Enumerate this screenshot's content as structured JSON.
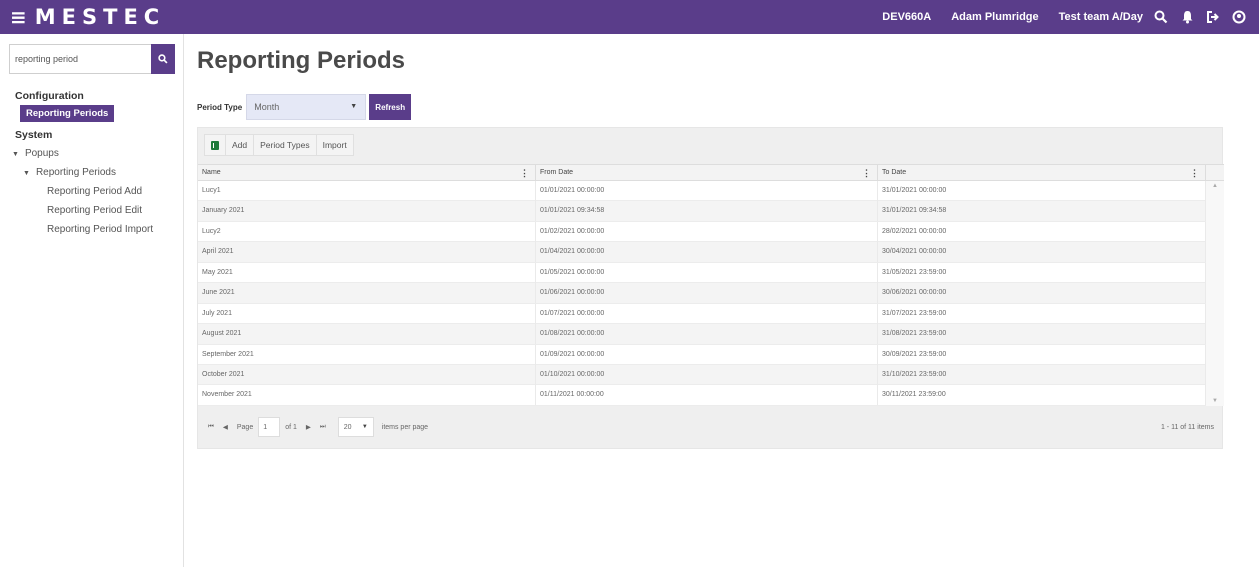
{
  "app": {
    "menu_icon": "hamburger-icon",
    "brand": "MESTEC"
  },
  "header": {
    "device": "DEV660A",
    "user": "Adam Plumridge",
    "team": "Test team A/Day",
    "icons": [
      "search-icon",
      "bell-icon",
      "logout-icon",
      "user-icon"
    ]
  },
  "sidebar": {
    "search_value": "reporting period",
    "search_icon": "search-icon",
    "configuration_label": "Configuration",
    "active_item": "Reporting Periods",
    "system_label": "System",
    "popups_label": "Popups",
    "reporting_periods_label": "Reporting Periods",
    "sub_items": [
      "Reporting Period Add",
      "Reporting Period Edit",
      "Reporting Period Import"
    ]
  },
  "main": {
    "title": "Reporting Periods",
    "filter": {
      "label": "Period Type",
      "value": "Month",
      "refresh_label": "Refresh"
    },
    "toolbar": {
      "excel_icon": "excel-icon",
      "add_label": "Add",
      "period_types_label": "Period Types",
      "import_label": "Import"
    },
    "grid": {
      "columns": [
        "Name",
        "From Date",
        "To Date"
      ],
      "rows": [
        [
          "Lucy1",
          "01/01/2021 00:00:00",
          "31/01/2021 00:00:00"
        ],
        [
          "January 2021",
          "01/01/2021 09:34:58",
          "31/01/2021 09:34:58"
        ],
        [
          "Lucy2",
          "01/02/2021 00:00:00",
          "28/02/2021 00:00:00"
        ],
        [
          "April 2021",
          "01/04/2021 00:00:00",
          "30/04/2021 00:00:00"
        ],
        [
          "May 2021",
          "01/05/2021 00:00:00",
          "31/05/2021 23:59:00"
        ],
        [
          "June 2021",
          "01/06/2021 00:00:00",
          "30/06/2021 00:00:00"
        ],
        [
          "July 2021",
          "01/07/2021 00:00:00",
          "31/07/2021 23:59:00"
        ],
        [
          "August 2021",
          "01/08/2021 00:00:00",
          "31/08/2021 23:59:00"
        ],
        [
          "September 2021",
          "01/09/2021 00:00:00",
          "30/09/2021 23:59:00"
        ],
        [
          "October 2021",
          "01/10/2021 00:00:00",
          "31/10/2021 23:59:00"
        ],
        [
          "November 2021",
          "01/11/2021 00:00:00",
          "30/11/2021 23:59:00"
        ]
      ]
    },
    "pager": {
      "page_label": "Page",
      "page_value": "1",
      "of_label": "of 1",
      "page_size": "20",
      "per_page_label": "items per page",
      "info": "1 - 11 of 11 items"
    }
  },
  "colors": {
    "brand_purple": "#5a3d8a",
    "select_bg": "#e5e8f6",
    "excel_green": "#1d7a3a"
  }
}
